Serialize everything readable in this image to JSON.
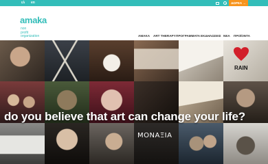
{
  "topbar": {
    "lang_gr": "ελ",
    "lang_en": "en",
    "donate_label": "ΔΩΡΕΑ →",
    "mail_icon": "mail-icon",
    "search_icon": "search-icon"
  },
  "logo": {
    "word": "amaka",
    "line1": "non",
    "line2": "profit",
    "line3": "organization"
  },
  "nav": {
    "items": [
      {
        "label": "AMAKA"
      },
      {
        "label": "ART THERAPY"
      },
      {
        "label": "ΠΡΟΓΡΑΜΜΑΤΑ"
      },
      {
        "label": "ΕΚΔΗΛΩΣΕΙΣ"
      },
      {
        "label": "ΝΕΑ"
      },
      {
        "label": "ΠΡΟΪΟΝΤΑ"
      }
    ]
  },
  "hero": {
    "headline": "do you believe that art can change your life?",
    "graffiti_text": "ΜΟΝΑΞΙΑ",
    "sign_text": "RAIN"
  },
  "colors": {
    "brand_teal": "#33bdb9",
    "donate_orange": "#f7941d"
  }
}
